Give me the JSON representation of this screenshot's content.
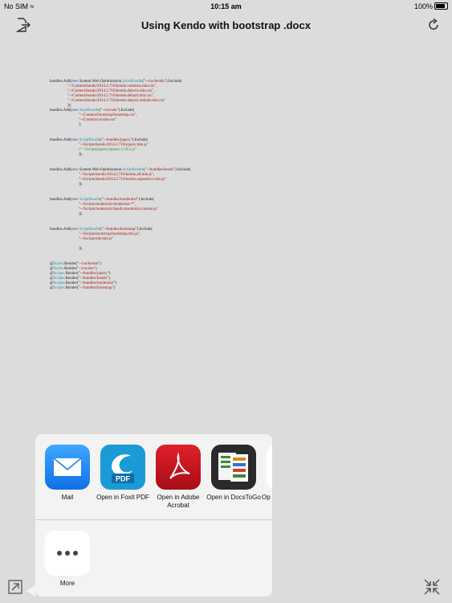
{
  "status": {
    "carrier": "No SIM",
    "time": "10:15 am",
    "battery": "100%"
  },
  "nav": {
    "title": "Using Kendo with bootstrap .docx",
    "left_icon": "export-icon",
    "right_icon": "refresh-icon"
  },
  "document": {
    "blocks": [
      [
        [
          {
            "t": "bundles.Add("
          },
          {
            "t": "new",
            "c": "kw"
          },
          {
            "t": " System.Web.Optimization."
          },
          {
            "t": "StyleBundle",
            "c": "cls"
          },
          {
            "t": "(\""
          },
          {
            "t": "~/css/kendo",
            "c": "str"
          },
          {
            "t": "\").Include("
          }
        ],
        [
          {
            "t": "\"~/Content/kendo/2014.2.716/kendo.common.min.css\",",
            "c": "str",
            "i": 1
          }
        ],
        [
          {
            "t": "\"~/Content/kendo/2014.2.716/kendo.dataviz.min.css\",",
            "c": "str",
            "i": 1
          }
        ],
        [
          {
            "t": "\"~/Content/kendo/2014.2.716/kendo.default.min.css\",",
            "c": "str",
            "i": 1
          }
        ],
        [
          {
            "t": "\"~/Content/kendo/2014.2.716/kendo.dataviz.default.min.css\"",
            "c": "str",
            "i": 1
          }
        ],
        [
          {
            "t": "));",
            "i": 1
          }
        ],
        [
          {
            "t": "bundles.Add("
          },
          {
            "t": "new",
            "c": "kw"
          },
          {
            "t": " "
          },
          {
            "t": "StyleBundle",
            "c": "cls"
          },
          {
            "t": "(\""
          },
          {
            "t": "~/css/site",
            "c": "str"
          },
          {
            "t": "\").Include("
          }
        ],
        [
          {
            "t": "\"~/Content/bootstrap/bootstrap.css\",",
            "c": "str",
            "i": 2
          }
        ],
        [
          {
            "t": "\"~/Content/css/site.css\"",
            "c": "str",
            "i": 2
          }
        ],
        [
          {
            "t": ");",
            "i": 2
          }
        ]
      ],
      [
        [
          {
            "t": "bundles.Add("
          },
          {
            "t": "new",
            "c": "kw"
          },
          {
            "t": " "
          },
          {
            "t": "ScriptBundle",
            "c": "cls"
          },
          {
            "t": "(\""
          },
          {
            "t": "~/bundles/jquery",
            "c": "str"
          },
          {
            "t": "\").Include("
          }
        ],
        [
          {
            "t": "\"~/Scripts/kendo/2014.2.716/jquery.min.js\"",
            "c": "str",
            "i": 2
          }
        ],
        [
          {
            "t": "//\"~/Scripts/jquery/jquery-1.10.2.js\"",
            "c": "cm",
            "i": 2
          }
        ],
        [
          {
            "t": "));",
            "i": 2
          }
        ]
      ],
      [
        [
          {
            "t": "bundles.Add("
          },
          {
            "t": "new",
            "c": "kw"
          },
          {
            "t": " System.Web.Optimization."
          },
          {
            "t": "ScriptBundle",
            "c": "cls"
          },
          {
            "t": "(\""
          },
          {
            "t": "~/bundles/kendo",
            "c": "str"
          },
          {
            "t": "\").Include("
          }
        ],
        [
          {
            "t": "\"~/Scripts/kendo/2014.2.716/kendo.all.min.js\",",
            "c": "str",
            "i": 2
          }
        ],
        [
          {
            "t": "\"~/Scripts/kendo/2014.2.716/kendo.aspnetmvc.min.js\"",
            "c": "str",
            "i": 2
          }
        ],
        [
          {
            "t": "));",
            "i": 2
          }
        ]
      ],
      [
        [
          {
            "t": "bundles.Add("
          },
          {
            "t": "new",
            "c": "kw"
          },
          {
            "t": " "
          },
          {
            "t": "ScriptBundle",
            "c": "cls"
          },
          {
            "t": "(\""
          },
          {
            "t": "~/bundles/modernizr",
            "c": "str"
          },
          {
            "t": "\").Include("
          }
        ],
        [
          {
            "t": "\"~/Scripts/modernizr/modernizr-*\",",
            "c": "str",
            "i": 2
          }
        ],
        [
          {
            "t": "\"~/Scripts/modernizr/kendo.modernizr.custom.js\"",
            "c": "str",
            "i": 2
          }
        ],
        [
          {
            "t": "));",
            "i": 2
          }
        ]
      ],
      [
        [
          {
            "t": "bundles.Add("
          },
          {
            "t": "new",
            "c": "kw"
          },
          {
            "t": " "
          },
          {
            "t": "ScriptBundle",
            "c": "cls"
          },
          {
            "t": "(\""
          },
          {
            "t": "~/bundles/bootstrap",
            "c": "str"
          },
          {
            "t": "\").Include("
          }
        ],
        [
          {
            "t": "\"~/Scripts/bootstrap/bootstrap.min.js\",",
            "c": "str",
            "i": 2
          }
        ],
        [
          {
            "t": "\"~/Scripts/site/site.js\"",
            "c": "str",
            "i": 2
          }
        ],
        [
          {
            "t": " "
          }
        ],
        [
          {
            "t": "));",
            "i": 2
          }
        ]
      ],
      [
        [
          {
            "t": "@"
          },
          {
            "t": "Styles",
            "c": "cls"
          },
          {
            "t": ".Render(\""
          },
          {
            "t": "~/css/kendo",
            "c": "str"
          },
          {
            "t": "\")"
          }
        ],
        [
          {
            "t": "@"
          },
          {
            "t": "Styles",
            "c": "cls"
          },
          {
            "t": ".Render(\""
          },
          {
            "t": "~/css/site",
            "c": "str"
          },
          {
            "t": "\")"
          }
        ],
        [
          {
            "t": "@"
          },
          {
            "t": "Scripts",
            "c": "cls"
          },
          {
            "t": ".Render(\""
          },
          {
            "t": "~/bundles/jquery",
            "c": "str"
          },
          {
            "t": "\")"
          }
        ],
        [
          {
            "t": "@"
          },
          {
            "t": "Scripts",
            "c": "cls"
          },
          {
            "t": ".Render(\""
          },
          {
            "t": "~/bundles/kendo",
            "c": "str"
          },
          {
            "t": "\")"
          }
        ],
        [
          {
            "t": "@"
          },
          {
            "t": "Scripts",
            "c": "cls"
          },
          {
            "t": ".Render(\""
          },
          {
            "t": "~/bundles/modernizr",
            "c": "str"
          },
          {
            "t": "\")"
          }
        ],
        [
          {
            "t": "@"
          },
          {
            "t": "Scripts",
            "c": "cls"
          },
          {
            "t": ".Render(\""
          },
          {
            "t": "~/bundles/bootstrap",
            "c": "str"
          },
          {
            "t": "\")"
          }
        ]
      ]
    ]
  },
  "share_sheet": {
    "apps": [
      {
        "label": "Mail",
        "icon": "mail-icon",
        "color": "#1e8cf0"
      },
      {
        "label": "Open in Foxit PDF",
        "icon": "foxit-pdf-icon",
        "color": "#1a9ad6"
      },
      {
        "label": "Open in Adobe Acrobat",
        "icon": "adobe-acrobat-icon",
        "color": "#c8101a"
      },
      {
        "label": "Open in DocsToGo",
        "icon": "docstogo-icon",
        "color": "#2a2a2a"
      },
      {
        "label": "Op",
        "icon": "partial-app-icon",
        "color": "#ffffff"
      }
    ],
    "more": {
      "label": "More",
      "icon": "more-dots-icon"
    }
  },
  "bottom": {
    "left_icon": "open-in-icon",
    "right_icon": "collapse-icon"
  }
}
